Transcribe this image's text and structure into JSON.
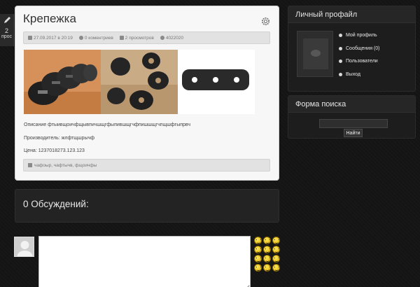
{
  "edge_tab": {
    "number": "2",
    "label": "прос"
  },
  "article": {
    "title": "Крепежка",
    "meta": {
      "date": "27.09.2017 в 20:19",
      "comments": "0 коментриев",
      "views": "2 просмотров",
      "author": "4022020"
    },
    "description": "Описание фтыивщоичфщывпичшщгфыпившщгчфпишшщгчпщшфгыпрвч",
    "manufacturer": "Производитель: жлфтщшрычф",
    "price": "Цена: 1237018273.123.123",
    "tags": "чафоыр, чафтычв, фщоичфы"
  },
  "discussions": {
    "title": "0 Обсуждений:"
  },
  "sidebar": {
    "profile": {
      "title": "Личный профайл",
      "links": [
        "Мой профиль",
        "Сообщения (0)",
        "Пользователи",
        "Выход"
      ]
    },
    "search": {
      "title": "Форма поиска",
      "input_value": "",
      "button_label": "Найти"
    }
  }
}
